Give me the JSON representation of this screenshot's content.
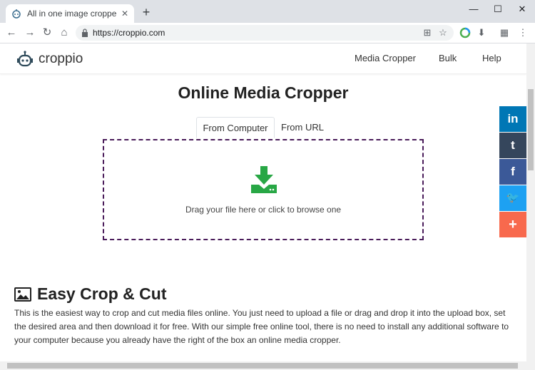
{
  "browser": {
    "tab_title": "All in one image cropper, mp",
    "tab_close": "✕",
    "new_tab": "+",
    "minimize": "—",
    "maximize": "☐",
    "close": "✕",
    "url": "https://croppio.com"
  },
  "site": {
    "logo_text": "croppio",
    "nav": [
      "Media Cropper",
      "Bulk",
      "Help"
    ]
  },
  "main": {
    "title": "Online Media Cropper",
    "source_tabs": [
      "From Computer",
      "From URL"
    ],
    "drop_text": "Drag your file here or click to browse one"
  },
  "feature": {
    "title": "Easy Crop & Cut",
    "text": "This is the easiest way to crop and cut media files online. You just need to upload a file or drag and drop it into the upload box, set the desired area and then download it for free. With our simple free online tool, there is no need to install any additional software to your computer because you already have the right of the box an online media cropper."
  },
  "share": [
    {
      "label": "in",
      "color": "#0077b5"
    },
    {
      "label": "t",
      "color": "#35465c"
    },
    {
      "label": "f",
      "color": "#3b5998"
    },
    {
      "label": "🐦",
      "color": "#1da1f2"
    },
    {
      "label": "+",
      "color": "#f8694d"
    }
  ],
  "colors": {
    "accent": "#28a745",
    "dropzone_border": "#4a1c5a"
  }
}
